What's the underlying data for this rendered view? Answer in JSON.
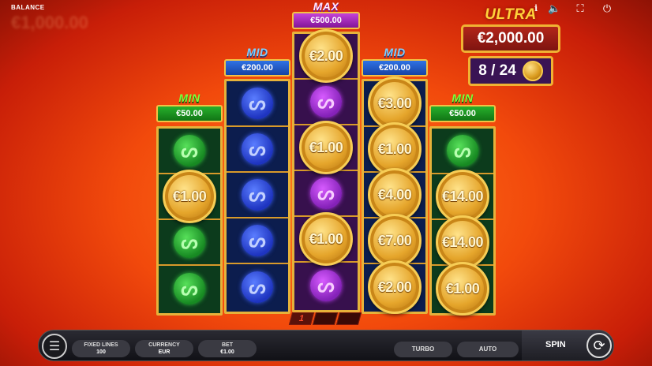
{
  "hud": {
    "balance_label": "BALANCE",
    "balance_value": "€1,000.00",
    "info_icon": "i",
    "sound_icon": "🔈",
    "fullscreen_icon": "⛶",
    "power_icon": "⏻"
  },
  "ultra": {
    "title": "ULTRA",
    "value": "€2,000.00",
    "count": "8 / 24"
  },
  "reels": [
    {
      "tier": "MIN",
      "prize": "€50.00"
    },
    {
      "tier": "MID",
      "prize": "€200.00"
    },
    {
      "tier": "MAX",
      "prize": "€500.00"
    },
    {
      "tier": "MID",
      "prize": "€200.00"
    },
    {
      "tier": "MIN",
      "prize": "€50.00"
    }
  ],
  "cells": {
    "r0": [
      "",
      "€1.00",
      "",
      ""
    ],
    "r1": [
      "",
      "",
      "",
      "",
      ""
    ],
    "r2": [
      "€2.00",
      "",
      "€1.00",
      "",
      "€1.00",
      ""
    ],
    "r3": [
      "",
      "€3.00",
      "€1.00",
      "€4.00",
      "€7.00",
      "€2.00"
    ],
    "r4": [
      "",
      "€14.00",
      "€14.00",
      "€1.00"
    ]
  },
  "pager": [
    "1",
    "",
    ""
  ],
  "controls": {
    "menu_icon": "☰",
    "fixed_lines_label": "FIXED LINES",
    "fixed_lines_value": "100",
    "currency_label": "CURRENCY",
    "currency_value": "EUR",
    "bet_label": "BET",
    "bet_value": "€1.00",
    "turbo_label": "TURBO",
    "auto_label": "AUTO",
    "spin_label": "SPIN",
    "spin_icon": "⟳"
  },
  "colors": {
    "min": "#27b02c",
    "mid": "#2f72e5",
    "max": "#c542d9",
    "frame_gold": "#e6b23a"
  }
}
